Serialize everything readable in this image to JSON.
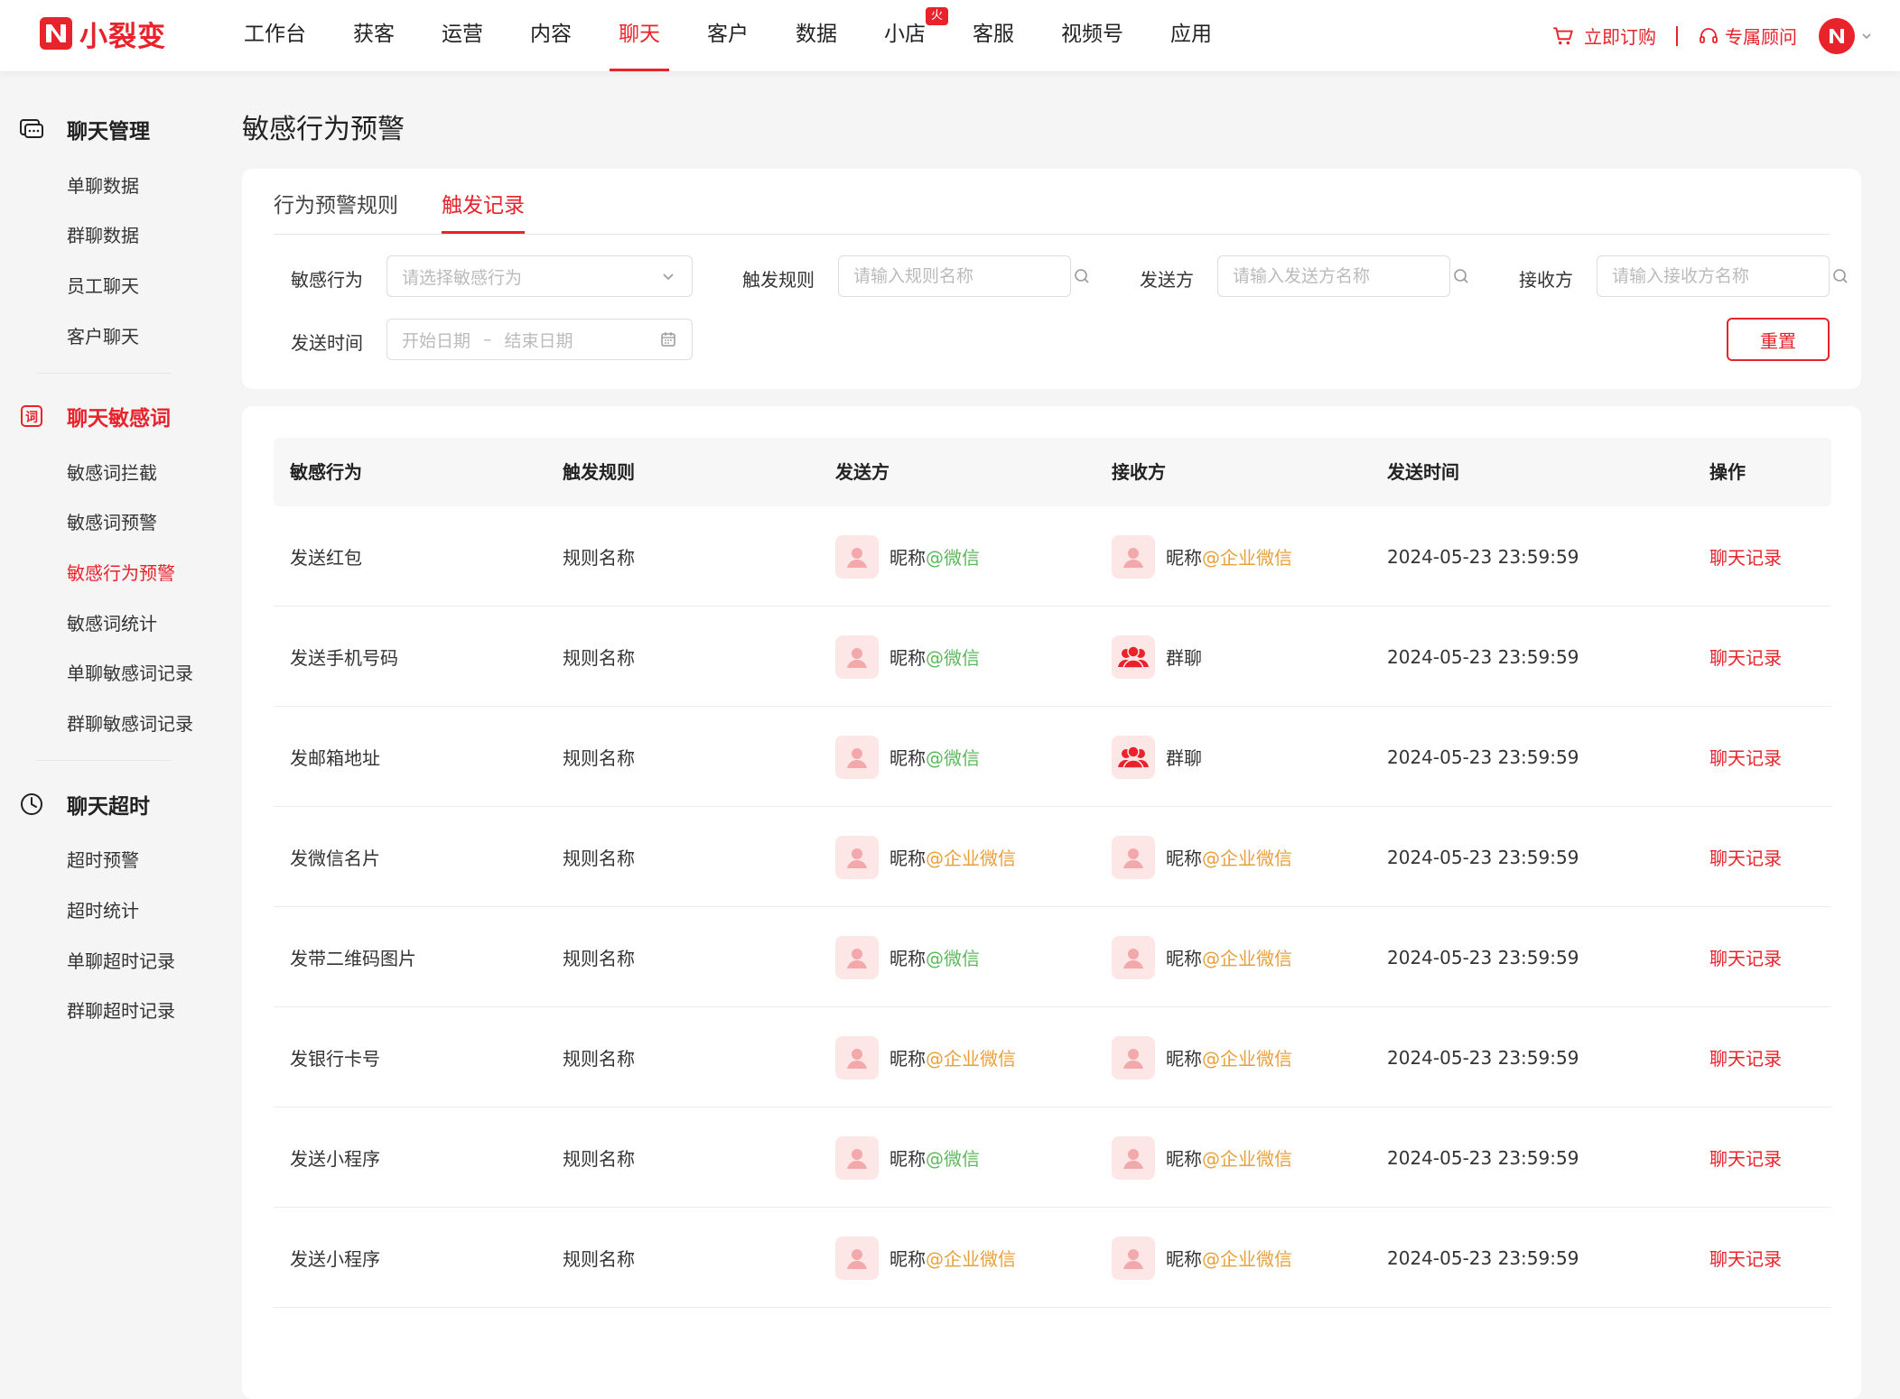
{
  "brand": {
    "name": "小裂变",
    "color": "#e8232c"
  },
  "nav": {
    "items": [
      {
        "label": "工作台"
      },
      {
        "label": "获客"
      },
      {
        "label": "运营"
      },
      {
        "label": "内容"
      },
      {
        "label": "聊天",
        "active": true
      },
      {
        "label": "客户"
      },
      {
        "label": "数据"
      },
      {
        "label": "小店",
        "badge": "火爆"
      },
      {
        "label": "客服"
      },
      {
        "label": "视频号"
      },
      {
        "label": "应用"
      }
    ],
    "order_label": "立即订购",
    "advisor_label": "专属顾问"
  },
  "sidebar": {
    "groups": [
      {
        "title": "聊天管理",
        "icon": "chat-icon",
        "items": [
          "单聊数据",
          "群聊数据",
          "员工聊天",
          "客户聊天"
        ]
      },
      {
        "title": "聊天敏感词",
        "icon": "sensitive-word-icon",
        "items": [
          "敏感词拦截",
          "敏感词预警",
          "敏感行为预警",
          "敏感词统计",
          "单聊敏感词记录",
          "群聊敏感词记录"
        ]
      },
      {
        "title": "聊天超时",
        "icon": "clock-icon",
        "items": [
          "超时预警",
          "超时统计",
          "单聊超时记录",
          "群聊超时记录"
        ]
      }
    ],
    "active_item": "敏感行为预警"
  },
  "page": {
    "title": "敏感行为预警"
  },
  "tabs": [
    {
      "label": "行为预警规则"
    },
    {
      "label": "触发记录",
      "active": true
    }
  ],
  "filters": {
    "behavior": {
      "label": "敏感行为",
      "placeholder": "请选择敏感行为"
    },
    "rule": {
      "label": "触发规则",
      "placeholder": "请输入规则名称"
    },
    "sender": {
      "label": "发送方",
      "placeholder": "请输入发送方名称"
    },
    "receiver": {
      "label": "接收方",
      "placeholder": "请输入接收方名称"
    },
    "time": {
      "label": "发送时间",
      "start": "开始日期",
      "dash": "–",
      "end": "结束日期"
    },
    "reset_label": "重置"
  },
  "table": {
    "columns": [
      "敏感行为",
      "触发规则",
      "发送方",
      "接收方",
      "发送时间",
      "操作"
    ],
    "rows": [
      {
        "behavior": "发送红包",
        "rule": "规则名称",
        "sender": {
          "name": "昵称",
          "tag": "@微信",
          "tag_type": "wx"
        },
        "receiver": {
          "name": "昵称",
          "tag": "@企业微信",
          "tag_type": "qw",
          "group": false
        },
        "time": "2024-05-23 23:59:59",
        "action": "聊天记录"
      },
      {
        "behavior": "发送手机号码",
        "rule": "规则名称",
        "sender": {
          "name": "昵称",
          "tag": "@微信",
          "tag_type": "wx"
        },
        "receiver": {
          "name": "群聊",
          "tag": "",
          "tag_type": "",
          "group": true
        },
        "time": "2024-05-23 23:59:59",
        "action": "聊天记录"
      },
      {
        "behavior": "发邮箱地址",
        "rule": "规则名称",
        "sender": {
          "name": "昵称",
          "tag": "@微信",
          "tag_type": "wx"
        },
        "receiver": {
          "name": "群聊",
          "tag": "",
          "tag_type": "",
          "group": true
        },
        "time": "2024-05-23 23:59:59",
        "action": "聊天记录"
      },
      {
        "behavior": "发微信名片",
        "rule": "规则名称",
        "sender": {
          "name": "昵称",
          "tag": "@企业微信",
          "tag_type": "qw"
        },
        "receiver": {
          "name": "昵称",
          "tag": "@企业微信",
          "tag_type": "qw",
          "group": false
        },
        "time": "2024-05-23 23:59:59",
        "action": "聊天记录"
      },
      {
        "behavior": "发带二维码图片",
        "rule": "规则名称",
        "sender": {
          "name": "昵称",
          "tag": "@微信",
          "tag_type": "wx"
        },
        "receiver": {
          "name": "昵称",
          "tag": "@企业微信",
          "tag_type": "qw",
          "group": false
        },
        "time": "2024-05-23 23:59:59",
        "action": "聊天记录"
      },
      {
        "behavior": "发银行卡号",
        "rule": "规则名称",
        "sender": {
          "name": "昵称",
          "tag": "@企业微信",
          "tag_type": "qw"
        },
        "receiver": {
          "name": "昵称",
          "tag": "@企业微信",
          "tag_type": "qw",
          "group": false
        },
        "time": "2024-05-23 23:59:59",
        "action": "聊天记录"
      },
      {
        "behavior": "发送小程序",
        "rule": "规则名称",
        "sender": {
          "name": "昵称",
          "tag": "@微信",
          "tag_type": "wx"
        },
        "receiver": {
          "name": "昵称",
          "tag": "@企业微信",
          "tag_type": "qw",
          "group": false
        },
        "time": "2024-05-23 23:59:59",
        "action": "聊天记录"
      },
      {
        "behavior": "发送小程序",
        "rule": "规则名称",
        "sender": {
          "name": "昵称",
          "tag": "@企业微信",
          "tag_type": "qw"
        },
        "receiver": {
          "name": "昵称",
          "tag": "@企业微信",
          "tag_type": "qw",
          "group": false
        },
        "time": "2024-05-23 23:59:59",
        "action": "聊天记录"
      }
    ]
  },
  "colors": {
    "accent": "#e8232c",
    "wechat_tag": "#5cb85c",
    "wework_tag": "#e8a03a",
    "avatar_bg": "#fde6e6"
  }
}
